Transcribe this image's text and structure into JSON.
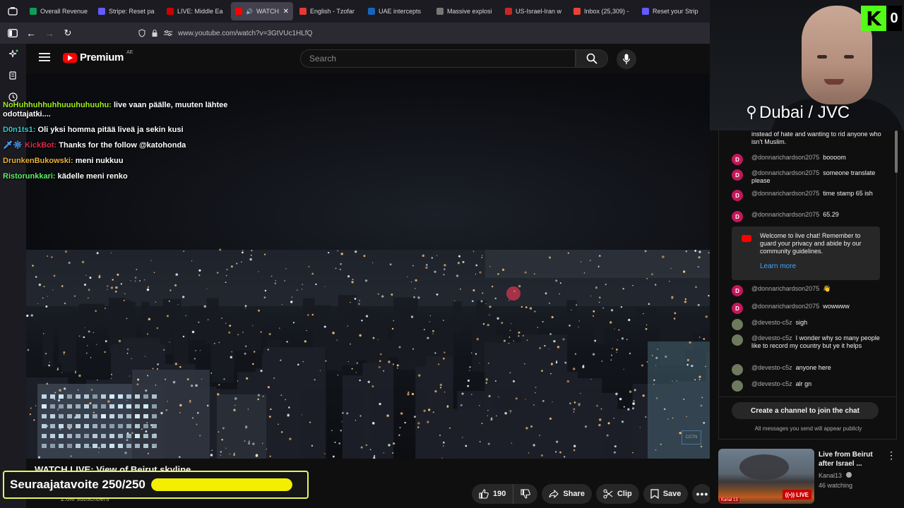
{
  "browser": {
    "tabs": [
      {
        "label": "Overall Revenue",
        "color": "#0f9d58",
        "active": false
      },
      {
        "label": "Stripe: Reset pa",
        "color": "#635bff",
        "active": false
      },
      {
        "label": "LIVE: Middle Ea",
        "color": "#cc0000",
        "active": false
      },
      {
        "label": "WATCH L",
        "color": "#ff0000",
        "active": true
      },
      {
        "label": "English - Tzofar",
        "color": "#e53935",
        "active": false
      },
      {
        "label": "UAE intercepts",
        "color": "#1565c0",
        "active": false
      },
      {
        "label": "Massive explosi",
        "color": "#777777",
        "active": false
      },
      {
        "label": "US-Israel-Iran w",
        "color": "#c62828",
        "active": false
      },
      {
        "label": "Inbox (25,309) -",
        "color": "#ea4335",
        "active": false
      },
      {
        "label": "Reset your Strip",
        "color": "#635bff",
        "active": false
      }
    ],
    "url": "www.youtube.com/watch?v=3GtVUc1HLfQ"
  },
  "youtube": {
    "logo_text": "Premium",
    "country_code": "AE",
    "search_placeholder": "Search"
  },
  "overlay_chat": [
    {
      "user": "NoHuhhuhhuhhuuuhuhuuhu:",
      "text": "live vaan päälle, muuten lähtee odottajatki....",
      "color": "#9ef01a"
    },
    {
      "user": "D0n1ts1:",
      "text": "Oli yksi homma pitää liveä ja sekin kusi",
      "color": "#37c9c9"
    },
    {
      "user": "KickBot:",
      "text": "Thanks for the follow @katohonda",
      "color": "#e02a4a"
    },
    {
      "user": "DrunkenBukowski:",
      "text": "meni nukkuu",
      "color": "#e8b33a"
    },
    {
      "user": "Ristorunkkari:",
      "text": "kädelle meni renko",
      "color": "#5ff06a"
    }
  ],
  "video": {
    "title": "WATCH LIVE: View of Beirut skyline",
    "subscribers": "2.6M subscribers",
    "watermark": "CGTN"
  },
  "actions": {
    "likes": "190",
    "share": "Share",
    "clip": "Clip",
    "save": "Save"
  },
  "goal": {
    "label": "Seuraajatavoite 250/250",
    "progress": 1.0,
    "bar_color": "#f4ee00",
    "border_color": "#e8f55a"
  },
  "stream": {
    "kick_logo": "K",
    "kick_count": "0",
    "location": "Dubai / JVC",
    "location_icon": "map-pin-icon"
  },
  "live_chat": {
    "partial_message": "instead of hate and wanting to rid anyone who isn't Muslim.",
    "messages": [
      {
        "author": "@donnarichardson2075",
        "text": "boooom",
        "avatar": "D",
        "avatar_color": "#c2185b"
      },
      {
        "author": "@donnarichardson2075",
        "text": "someone translate please",
        "avatar": "D",
        "avatar_color": "#c2185b"
      },
      {
        "author": "@donnarichardson2075",
        "text": "time stamp 65 ish",
        "avatar": "D",
        "avatar_color": "#c2185b"
      },
      {
        "author": "@donnarichardson2075",
        "text": "65.29",
        "avatar": "D",
        "avatar_color": "#c2185b"
      }
    ],
    "welcome": {
      "text": "Welcome to live chat! Remember to guard your privacy and abide by our community guidelines.",
      "link": "Learn more"
    },
    "messages_after": [
      {
        "author": "@donnarichardson2075",
        "text": "👋",
        "avatar": "D",
        "avatar_color": "#c2185b"
      },
      {
        "author": "@donnarichardson2075",
        "text": "wowwww",
        "avatar": "D",
        "avatar_color": "#c2185b"
      },
      {
        "author": "@devesto-c5z",
        "text": "sigh",
        "avatar": "",
        "avatar_color": "#6d7a5e"
      },
      {
        "author": "@devesto-c5z",
        "text": "I wonder why so many people like to record my country but ye it helps",
        "avatar": "",
        "avatar_color": "#6d7a5e"
      },
      {
        "author": "@devesto-c5z",
        "text": "anyone here",
        "avatar": "",
        "avatar_color": "#6d7a5e"
      },
      {
        "author": "@devesto-c5z",
        "text": "alr gn",
        "avatar": "",
        "avatar_color": "#6d7a5e"
      }
    ],
    "join_button": "Create a channel to join the chat",
    "footer_note": "All messages you send will appear publicly"
  },
  "related": {
    "title": "Live from Beirut after Israel ...",
    "channel": "Kanal13",
    "watching": "46 watching",
    "live_label": "LIVE",
    "thumb_tag": "Kanal 13"
  }
}
